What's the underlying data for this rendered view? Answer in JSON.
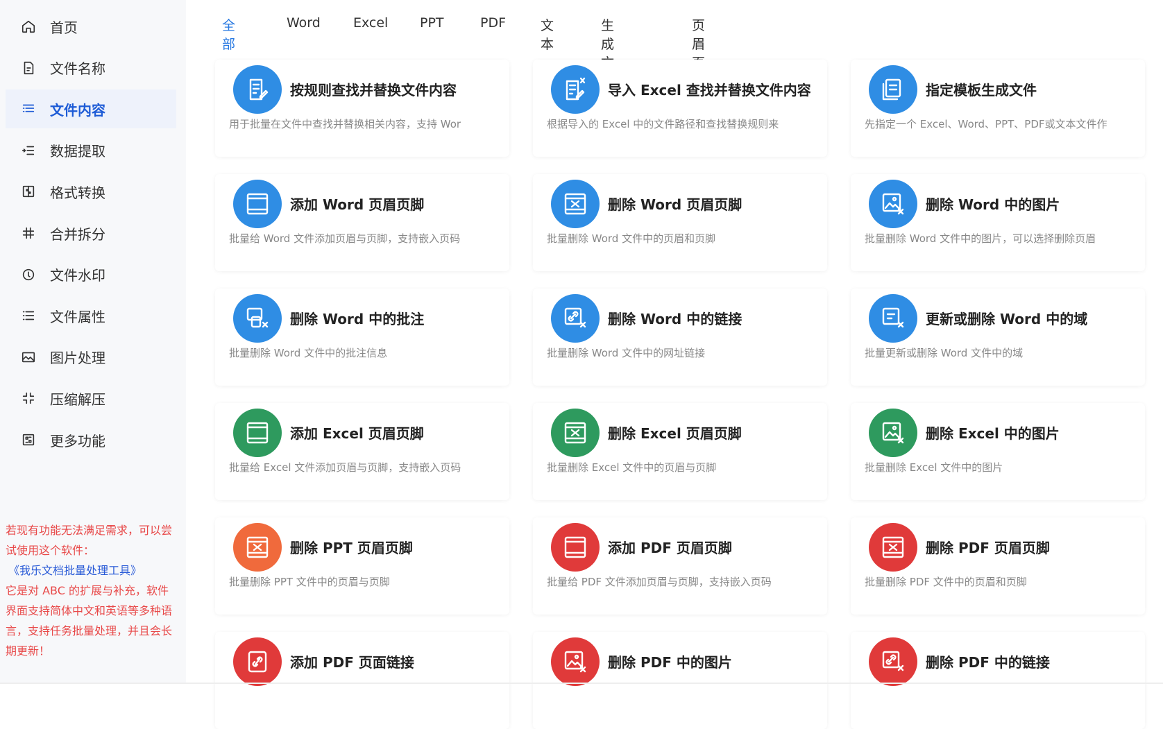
{
  "sidebar": {
    "items": [
      {
        "label": "首页",
        "icon": "home-icon"
      },
      {
        "label": "文件名称",
        "icon": "file-name-icon"
      },
      {
        "label": "文件内容",
        "icon": "file-content-icon",
        "active": true
      },
      {
        "label": "数据提取",
        "icon": "data-extract-icon"
      },
      {
        "label": "格式转换",
        "icon": "format-convert-icon"
      },
      {
        "label": "合并拆分",
        "icon": "merge-split-icon"
      },
      {
        "label": "文件水印",
        "icon": "watermark-icon"
      },
      {
        "label": "文件属性",
        "icon": "file-attribute-icon"
      },
      {
        "label": "图片处理",
        "icon": "image-process-icon"
      },
      {
        "label": "压缩解压",
        "icon": "compress-icon"
      },
      {
        "label": "更多功能",
        "icon": "more-icon"
      }
    ],
    "promo": {
      "line1": "若现有功能无法满足需求，可以尝试使用这个软件：",
      "link": "《我乐文档批量处理工具》",
      "line2": "它是对 ABC 的扩展与补充，软件界面支持简体中文和英语等多种语言，支持任务批量处理，并且会长期更新！"
    }
  },
  "tabs": [
    "全部",
    "Word",
    "Excel",
    "PPT",
    "PDF",
    "文本",
    "生成文件",
    "页眉页脚"
  ],
  "active_tab": "全部",
  "colors": {
    "blue": "#2f8de4",
    "green": "#2e9a5e",
    "orange": "#f06a3c",
    "red": "#e03a3a",
    "accent": "#2a7ae2",
    "promo_red": "#e84848",
    "promo_link": "#2a5bd7"
  },
  "cards": [
    {
      "title": "按规则查找并替换文件内容",
      "desc": "用于批量在文件中查找并替换相关内容，支持 Wor",
      "icon": "edit-doc-icon",
      "color": "blue"
    },
    {
      "title": "导入 Excel 查找并替换文件内容",
      "desc": "根据导入的 Excel 中的文件路径和查找替换规则来",
      "icon": "excel-edit-icon",
      "color": "blue"
    },
    {
      "title": "指定模板生成文件",
      "desc": "先指定一个 Excel、Word、PPT、PDF或文本文件作",
      "icon": "template-icon",
      "color": "blue"
    },
    {
      "title": "添加 Word 页眉页脚",
      "desc": "批量给 Word 文件添加页眉与页脚，支持嵌入页码",
      "icon": "add-header-icon",
      "color": "blue"
    },
    {
      "title": "删除 Word 页眉页脚",
      "desc": "批量删除 Word 文件中的页眉和页脚",
      "icon": "delete-header-icon",
      "color": "blue"
    },
    {
      "title": "删除 Word 中的图片",
      "desc": "批量删除 Word 文件中的图片，可以选择删除页眉",
      "icon": "delete-image-icon",
      "color": "blue"
    },
    {
      "title": "删除 Word 中的批注",
      "desc": "批量删除 Word 文件中的批注信息",
      "icon": "delete-comment-icon",
      "color": "blue"
    },
    {
      "title": "删除 Word 中的链接",
      "desc": "批量删除 Word 文件中的网址链接",
      "icon": "delete-link-icon",
      "color": "blue"
    },
    {
      "title": "更新或删除 Word 中的域",
      "desc": "批量更新或删除 Word 文件中的域",
      "icon": "field-icon",
      "color": "blue"
    },
    {
      "title": "添加 Excel 页眉页脚",
      "desc": "批量给 Excel 文件添加页眉与页脚，支持嵌入页码",
      "icon": "add-header-icon",
      "color": "green"
    },
    {
      "title": "删除 Excel 页眉页脚",
      "desc": "批量删除 Excel 文件中的页眉与页脚",
      "icon": "delete-header-icon",
      "color": "green"
    },
    {
      "title": "删除 Excel 中的图片",
      "desc": "批量删除 Excel 文件中的图片",
      "icon": "delete-image-icon",
      "color": "green"
    },
    {
      "title": "删除 PPT 页眉页脚",
      "desc": "批量删除 PPT 文件中的页眉与页脚",
      "icon": "delete-header-icon",
      "color": "orange"
    },
    {
      "title": "添加 PDF 页眉页脚",
      "desc": "批量给 PDF 文件添加页眉与页脚，支持嵌入页码",
      "icon": "add-header-icon",
      "color": "red"
    },
    {
      "title": "删除 PDF 页眉页脚",
      "desc": "批量删除 PDF 文件中的页眉和页脚",
      "icon": "delete-header-icon",
      "color": "red"
    },
    {
      "title": "添加 PDF 页面链接",
      "desc": "",
      "icon": "add-link-icon",
      "color": "red"
    },
    {
      "title": "删除 PDF 中的图片",
      "desc": "",
      "icon": "delete-image-icon",
      "color": "red"
    },
    {
      "title": "删除 PDF 中的链接",
      "desc": "",
      "icon": "delete-link-icon",
      "color": "red"
    }
  ]
}
